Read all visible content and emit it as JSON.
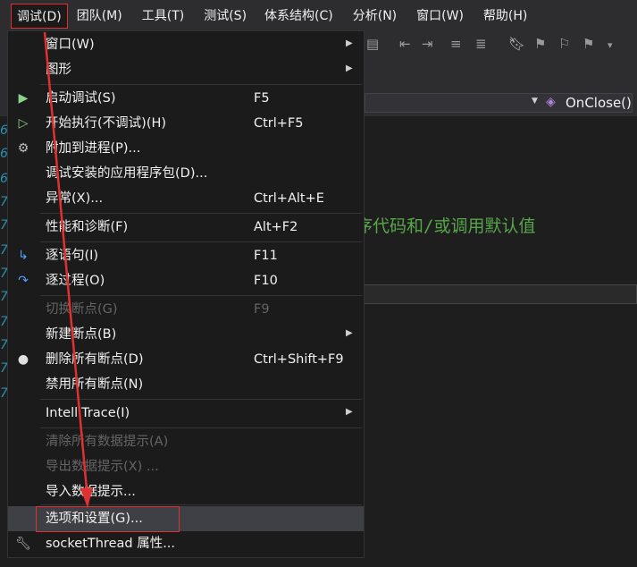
{
  "menubar": {
    "items": [
      {
        "label": "调试(D)",
        "active": true
      },
      {
        "label": "团队(M)"
      },
      {
        "label": "工具(T)"
      },
      {
        "label": "测试(S)"
      },
      {
        "label": "体系结构(C)"
      },
      {
        "label": "分析(N)"
      },
      {
        "label": "窗口(W)"
      },
      {
        "label": "帮助(H)"
      }
    ]
  },
  "navbar": {
    "member_label": "OnClose()",
    "member_icon": "method-cube-icon"
  },
  "editor": {
    "comment_text": "序代码和/或调用默认值"
  },
  "debug_menu": {
    "items": [
      {
        "label": "窗口(W)",
        "shortcut": "",
        "submenu": true,
        "icon": ""
      },
      {
        "label": "图形",
        "shortcut": "",
        "submenu": true,
        "icon": ""
      },
      {
        "label": "启动调试(S)",
        "shortcut": "F5",
        "icon": "play-icon"
      },
      {
        "label": "开始执行(不调试)(H)",
        "shortcut": "Ctrl+F5",
        "icon": "play-outline-icon"
      },
      {
        "label": "附加到进程(P)...",
        "shortcut": "",
        "icon": "gears-icon"
      },
      {
        "label": "调试安装的应用程序包(D)...",
        "shortcut": "",
        "icon": ""
      },
      {
        "label": "异常(X)...",
        "shortcut": "Ctrl+Alt+E",
        "icon": ""
      },
      {
        "label": "性能和诊断(F)",
        "shortcut": "Alt+F2",
        "icon": ""
      },
      {
        "label": "逐语句(I)",
        "shortcut": "F11",
        "icon": "step-into-icon"
      },
      {
        "label": "逐过程(O)",
        "shortcut": "F10",
        "icon": "step-over-icon"
      },
      {
        "label": "切换断点(G)",
        "shortcut": "F9",
        "icon": "",
        "disabled": true
      },
      {
        "label": "新建断点(B)",
        "shortcut": "",
        "submenu": true,
        "icon": ""
      },
      {
        "label": "删除所有断点(D)",
        "shortcut": "Ctrl+Shift+F9",
        "icon": "delete-breakpoints-icon"
      },
      {
        "label": "禁用所有断点(N)",
        "shortcut": "",
        "icon": ""
      },
      {
        "label": "IntelliTrace(I)",
        "shortcut": "",
        "submenu": true,
        "icon": ""
      },
      {
        "label": "清除所有数据提示(A)",
        "shortcut": "",
        "icon": "",
        "disabled": true
      },
      {
        "label": "导出数据提示(X) ...",
        "shortcut": "",
        "icon": "",
        "disabled": true
      },
      {
        "label": "导入数据提示...",
        "shortcut": "",
        "icon": ""
      },
      {
        "label": "选项和设置(G)...",
        "shortcut": "",
        "icon": "",
        "highlighted": true
      },
      {
        "label": "socketThread 属性...",
        "shortcut": "",
        "icon": "wrench-icon"
      }
    ]
  },
  "colors": {
    "annotation_red": "#e03030",
    "menu_bg": "#1b1b1c",
    "comment_green": "#57a64a"
  }
}
